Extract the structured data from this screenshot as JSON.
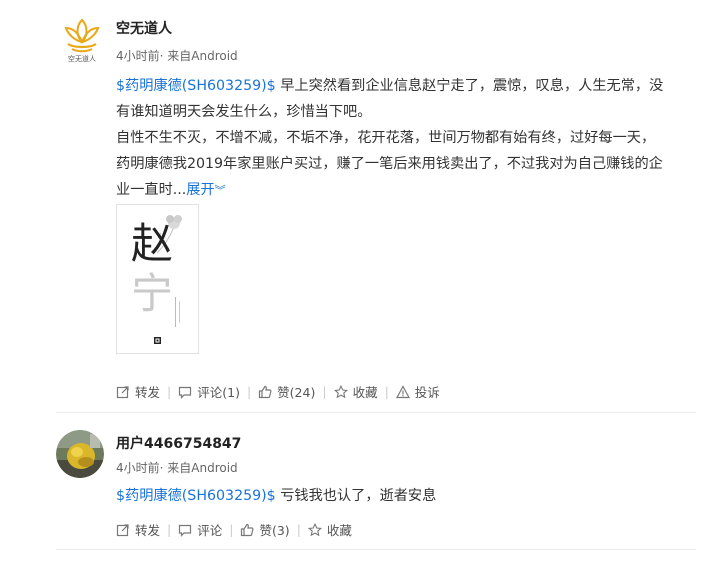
{
  "post1": {
    "avatar_caption": "空无道人",
    "username": "空无道人",
    "meta": "4小时前· 来自Android",
    "stock_tag": "$药明康德(SH603259)$",
    "lines": [
      " 早上突然看到企业信息赵宁走了，震惊，叹息，人生无常，没",
      "有谁知道明天会发生什么，珍惜当下吧。",
      "自性不生不灭，不增不减，不垢不净，花开花落，世间万物都有始有终，过好每一天，",
      "药明康德我2019年家里账户买过，赚了一笔后来用钱卖出了，不过我对为自己赚钱的企",
      "业一直时..."
    ],
    "expand_label": "展开",
    "thumb_text": "赵宁",
    "actions": {
      "repost": "转发",
      "comment": "评论(1)",
      "like": "赞(24)",
      "favorite": "收藏",
      "report": "投诉"
    }
  },
  "post2": {
    "username": "用户4466754847",
    "meta": "4小时前· 来自Android",
    "stock_tag": "$药明康德(SH603259)$",
    "text": " 亏钱我也认了，逝者安息",
    "actions": {
      "repost": "转发",
      "comment": "评论",
      "like": "赞(3)",
      "favorite": "收藏"
    }
  },
  "colors": {
    "link": "#1a73d9",
    "text": "#333333",
    "meta": "#666666",
    "logo_gold": "#e8a818"
  }
}
